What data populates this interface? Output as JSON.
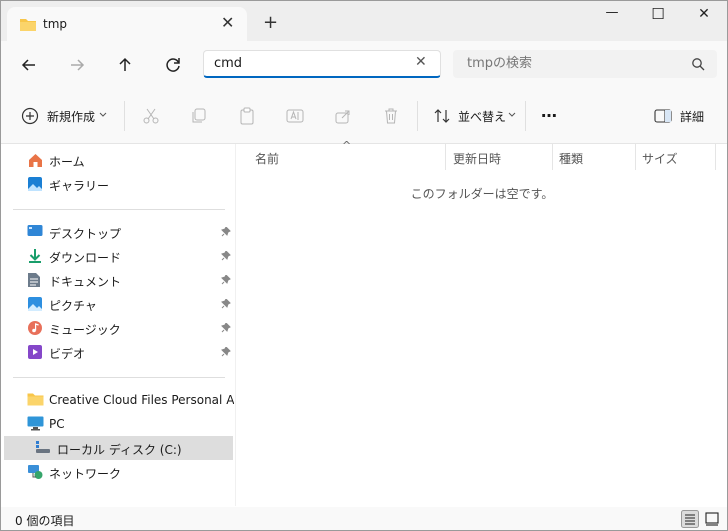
{
  "tab": {
    "title": "tmp",
    "close": "✕",
    "new": "+"
  },
  "window": {
    "minimize": "—",
    "maximize": "☐",
    "close": "✕"
  },
  "address": {
    "value": "cmd",
    "clear": "✕"
  },
  "search": {
    "placeholder": "tmpの検索"
  },
  "toolbar": {
    "new_label": "新規作成",
    "sort_label": "並べ替え",
    "more_label": "…",
    "details_label": "詳細"
  },
  "nav": {
    "home": "ホーム",
    "gallery": "ギャラリー",
    "desktop": "デスクトップ",
    "downloads": "ダウンロード",
    "documents": "ドキュメント",
    "pictures": "ピクチャ",
    "music": "ミュージック",
    "videos": "ビデオ",
    "creative_cloud": "Creative Cloud Files Personal Account",
    "pc": "PC",
    "local_disk": "ローカル ディスク (C:)",
    "network": "ネットワーク"
  },
  "columns": {
    "name": "名前",
    "modified": "更新日時",
    "type": "種類",
    "size": "サイズ",
    "sort_indicator": "^"
  },
  "content": {
    "empty_message": "このフォルダーは空です。"
  },
  "status": {
    "item_count": "0 個の項目"
  },
  "colors": {
    "accent": "#0067c0",
    "folder": "#f8c649",
    "selected": "#dddddd"
  }
}
